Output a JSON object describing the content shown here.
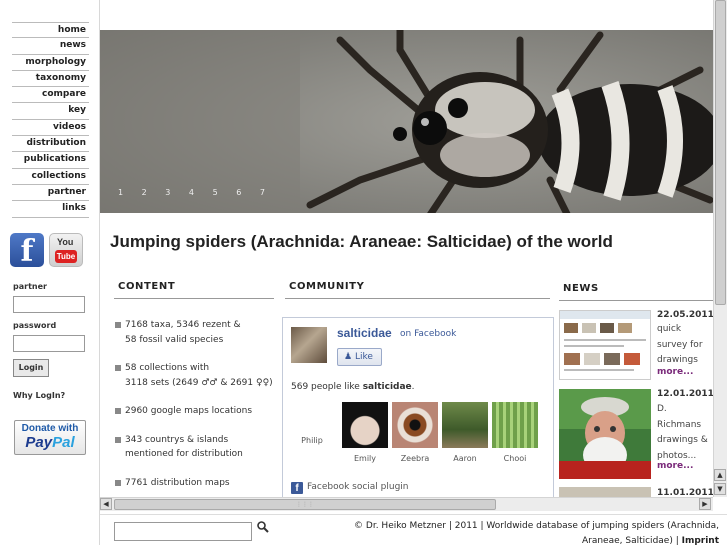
{
  "nav": {
    "items": [
      {
        "label": "home"
      },
      {
        "label": "news"
      },
      {
        "label": "morphology"
      },
      {
        "label": "taxonomy"
      },
      {
        "label": "compare"
      },
      {
        "label": "key"
      },
      {
        "label": "videos"
      },
      {
        "label": "distribution"
      },
      {
        "label": "publications"
      },
      {
        "label": "collections"
      },
      {
        "label": "partner"
      },
      {
        "label": "links"
      }
    ]
  },
  "social": {
    "facebook_icon": "f",
    "youtube_you": "You",
    "youtube_tube": "Tube"
  },
  "login": {
    "partner_label": "partner",
    "password_label": "password",
    "button_label": "Login",
    "why_login": "Why LogIn?"
  },
  "donate": {
    "line1": "Donate with",
    "paypal_a": "Pay",
    "paypal_b": "Pal"
  },
  "banner": {
    "slides": [
      "1",
      "2",
      "3",
      "4",
      "5",
      "6",
      "7"
    ]
  },
  "page_title": "Jumping spiders (Arachnida: Araneae: Salticidae) of the world",
  "sections": {
    "content": "CONTENT",
    "community": "COMMUNITY",
    "news": "NEWS"
  },
  "content_stats": [
    {
      "line1": "7168 taxa, 5346 rezent &",
      "line2": "58 fossil valid species"
    },
    {
      "line1": "58 collections with",
      "line2": "3118 sets (2649 ♂♂ & 2691 ♀♀)"
    },
    {
      "line1": "2960 google maps locations",
      "line2": ""
    },
    {
      "line1": "343 countrys & islands",
      "line2": "mentioned for distribution"
    },
    {
      "line1": "7761 distribution maps",
      "line2": ""
    }
  ],
  "facebook": {
    "page_name": "salticidae",
    "on_facebook": "on Facebook",
    "like_button": "Like",
    "like_count_prefix": "569 people like ",
    "like_count_name": "salticidae",
    "like_count_suffix": ".",
    "friends": [
      {
        "name": "Philip"
      },
      {
        "name": "Emily"
      },
      {
        "name": "Zeebra"
      },
      {
        "name": "Aaron"
      },
      {
        "name": "Chooi"
      }
    ],
    "plugin_label": "Facebook social plugin"
  },
  "news": [
    {
      "date": "22.05.2011",
      "text": "quick survey for drawings",
      "more": "more..."
    },
    {
      "date": "12.01.2011",
      "text": "D. Richmans drawings & photos...",
      "more": "more..."
    },
    {
      "date": "11.01.2011",
      "text": "",
      "more": ""
    }
  ],
  "footer": {
    "search_placeholder": "",
    "copyright": "© Dr. Heiko Metzner | 2011 | Worldwide database of jumping spiders (Arachnida, Araneae, Salticidae) | ",
    "imprint": "Imprint"
  },
  "colors": {
    "facebook_blue": "#3b5998",
    "news_more": "#7a2a7a",
    "paypal_dark": "#1d3c8f",
    "paypal_light": "#2aa1de"
  }
}
